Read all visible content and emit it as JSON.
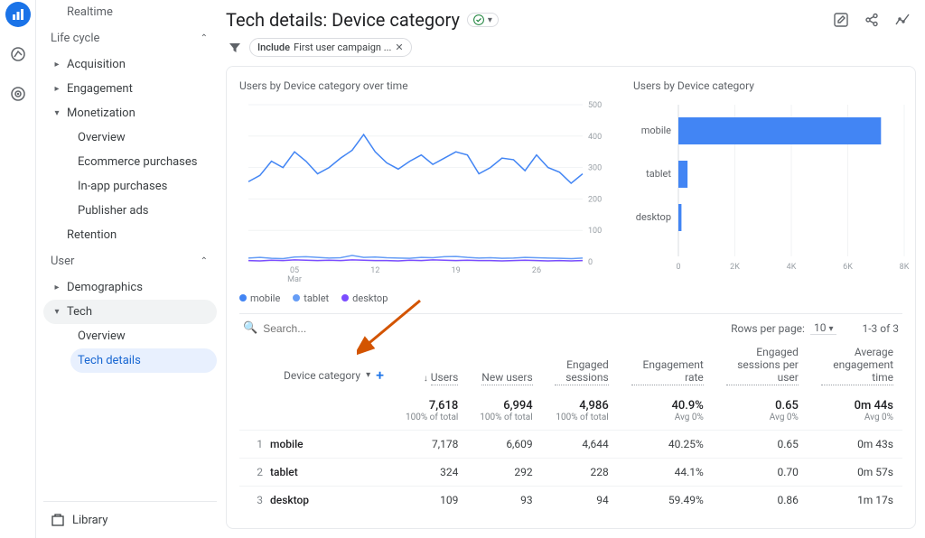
{
  "sidebar": {
    "realtime": "Realtime",
    "lifecycle_header": "Life cycle",
    "acquisition": "Acquisition",
    "engagement": "Engagement",
    "monetization": "Monetization",
    "overview": "Overview",
    "ecomm": "Ecommerce purchases",
    "inapp": "In-app purchases",
    "pubads": "Publisher ads",
    "retention": "Retention",
    "user_header": "User",
    "demographics": "Demographics",
    "tech": "Tech",
    "tech_overview": "Overview",
    "tech_details": "Tech details",
    "library": "Library"
  },
  "header": {
    "title": "Tech details: Device category",
    "filter_label": "Include",
    "filter_value": "First user campaign ..."
  },
  "charts": {
    "title_left": "Users by Device category over time",
    "title_right": "Users by Device category",
    "legend": {
      "mobile": "mobile",
      "tablet": "tablet",
      "desktop": "desktop"
    },
    "colors": {
      "mobile": "#4285f4",
      "tablet": "#669df6",
      "desktop": "#7b4dff"
    }
  },
  "table": {
    "search_placeholder": "Search...",
    "rows_per_page_label": "Rows per page:",
    "rows_per_page_value": "10",
    "page_info": "1-3 of 3",
    "dimension_label": "Device category",
    "cols": {
      "users": "Users",
      "new_users": "New users",
      "engaged_sessions": "Engaged sessions",
      "engagement_rate": "Engagement rate",
      "eng_per_user": "Engaged sessions per user",
      "avg_eng_time": "Average engagement time"
    },
    "totals": {
      "users": "7,618",
      "users_sub": "100% of total",
      "new_users": "6,994",
      "new_users_sub": "100% of total",
      "eng_sess": "4,986",
      "eng_sess_sub": "100% of total",
      "eng_rate": "40.9%",
      "eng_rate_sub": "Avg 0%",
      "eng_per_user": "0.65",
      "eng_per_user_sub": "Avg 0%",
      "avg_time": "0m 44s",
      "avg_time_sub": "Avg 0%"
    },
    "rows": [
      {
        "n": "1",
        "dim": "mobile",
        "users": "7,178",
        "new_users": "6,609",
        "eng_sess": "4,644",
        "eng_rate": "40.25%",
        "eng_per_user": "0.65",
        "avg_time": "0m 43s"
      },
      {
        "n": "2",
        "dim": "tablet",
        "users": "324",
        "new_users": "292",
        "eng_sess": "228",
        "eng_rate": "44.1%",
        "eng_per_user": "0.70",
        "avg_time": "0m 57s"
      },
      {
        "n": "3",
        "dim": "desktop",
        "users": "109",
        "new_users": "93",
        "eng_sess": "94",
        "eng_rate": "59.49%",
        "eng_per_user": "0.86",
        "avg_time": "1m 17s"
      }
    ]
  },
  "chart_data": [
    {
      "type": "line",
      "title": "Users by Device category over time",
      "ylabel": "",
      "xlabel": "",
      "ylim": [
        0,
        500
      ],
      "x_ticks": [
        "05 Mar",
        "12",
        "19",
        "26"
      ],
      "x": [
        1,
        2,
        3,
        4,
        5,
        6,
        7,
        8,
        9,
        10,
        11,
        12,
        13,
        14,
        15,
        16,
        17,
        18,
        19,
        20,
        21,
        22,
        23,
        24,
        25,
        26,
        27,
        28,
        29,
        30
      ],
      "series": [
        {
          "name": "mobile",
          "color": "#4285f4",
          "values": [
            255,
            275,
            320,
            300,
            350,
            320,
            280,
            300,
            330,
            355,
            405,
            350,
            315,
            295,
            320,
            340,
            310,
            330,
            350,
            340,
            280,
            300,
            330,
            325,
            290,
            340,
            300,
            285,
            250,
            280
          ]
        },
        {
          "name": "tablet",
          "color": "#669df6",
          "values": [
            12,
            14,
            11,
            10,
            15,
            16,
            14,
            12,
            13,
            20,
            14,
            15,
            13,
            12,
            11,
            14,
            13,
            16,
            17,
            14,
            12,
            13,
            11,
            12,
            14,
            13,
            12,
            11,
            10,
            12
          ]
        },
        {
          "name": "desktop",
          "color": "#7b4dff",
          "values": [
            4,
            3,
            5,
            4,
            6,
            5,
            4,
            5,
            4,
            6,
            5,
            4,
            4,
            3,
            5,
            4,
            6,
            5,
            4,
            5,
            4,
            4,
            3,
            4,
            5,
            4,
            3,
            4,
            3,
            4
          ]
        }
      ]
    },
    {
      "type": "bar",
      "orientation": "horizontal",
      "title": "Users by Device category",
      "xlim": [
        0,
        8000
      ],
      "x_ticks": [
        "0",
        "2K",
        "4K",
        "6K",
        "8K"
      ],
      "categories": [
        "mobile",
        "tablet",
        "desktop"
      ],
      "values": [
        7178,
        324,
        109
      ],
      "color": "#4285f4"
    }
  ]
}
